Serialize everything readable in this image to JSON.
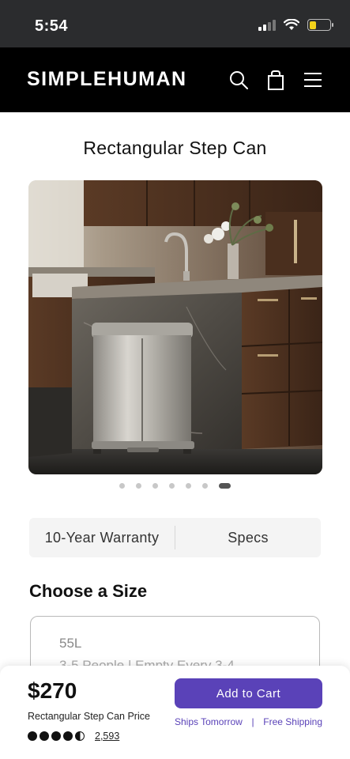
{
  "status_bar": {
    "time": "5:54",
    "signal_bars": 4,
    "signal_bars_active": 2,
    "battery_level": 0.35,
    "battery_color": "#f2d21a"
  },
  "header": {
    "logo": "SIMPLEHUMAN",
    "icons": [
      "search-icon",
      "shopping-bag-icon",
      "menu-icon"
    ]
  },
  "product": {
    "title": "Rectangular Step Can",
    "image_alt": "stainless steel step can in kitchen",
    "carousel": {
      "count": 7,
      "active_index": 6
    }
  },
  "info_tabs": [
    "10-Year Warranty",
    "Specs"
  ],
  "size_section": {
    "title": "Choose a Size",
    "options": [
      {
        "name": "55L",
        "description": "3-5 People | Empty Every 3-4"
      }
    ]
  },
  "purchase_bar": {
    "price": "$270",
    "price_label": "Rectangular Step Can Price",
    "rating": 4.5,
    "review_count": "2,593",
    "cart_label": "Add to Cart",
    "ships": "Ships Tomorrow",
    "separator": "|",
    "free_shipping": "Free Shipping",
    "accent": "#5a42b8"
  }
}
